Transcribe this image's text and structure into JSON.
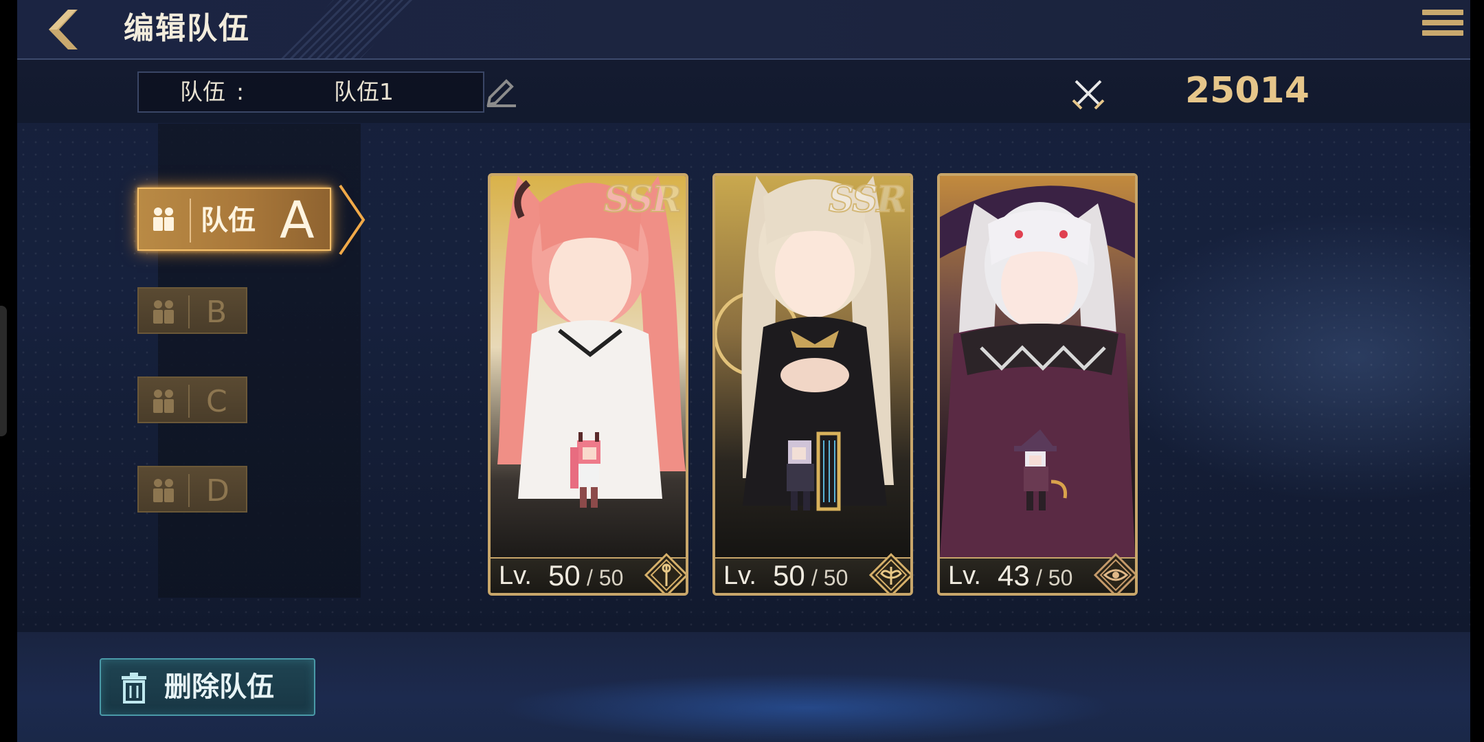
{
  "header": {
    "title": "编辑队伍"
  },
  "team_bar": {
    "label": "队伍",
    "colon": ":",
    "team_name": "队伍1",
    "combat_power": "25014"
  },
  "tabs": [
    {
      "name": "队伍",
      "letter": "A",
      "active": true
    },
    {
      "name": "",
      "letter": "B",
      "active": false
    },
    {
      "name": "",
      "letter": "C",
      "active": false
    },
    {
      "name": "",
      "letter": "D",
      "active": false
    }
  ],
  "cards": [
    {
      "rarity": "SSR",
      "level_label": "Lv.",
      "level": "50",
      "max_level": "/ 50",
      "class_icon": "staff-class-icon",
      "palette": "pink"
    },
    {
      "rarity": "SSR",
      "level_label": "Lv.",
      "level": "50",
      "max_level": "/ 50",
      "class_icon": "wing-class-icon",
      "palette": "blonde"
    },
    {
      "rarity": "",
      "level_label": "Lv.",
      "level": "43",
      "max_level": "/ 50",
      "class_icon": "eye-class-icon",
      "palette": "silver"
    }
  ],
  "footer": {
    "delete_label": "删除队伍"
  },
  "colors": {
    "gold": "#c8a66a",
    "power": "#e6c68a",
    "tab_active": "#b98a45",
    "delete_border": "#4a9aa8"
  }
}
